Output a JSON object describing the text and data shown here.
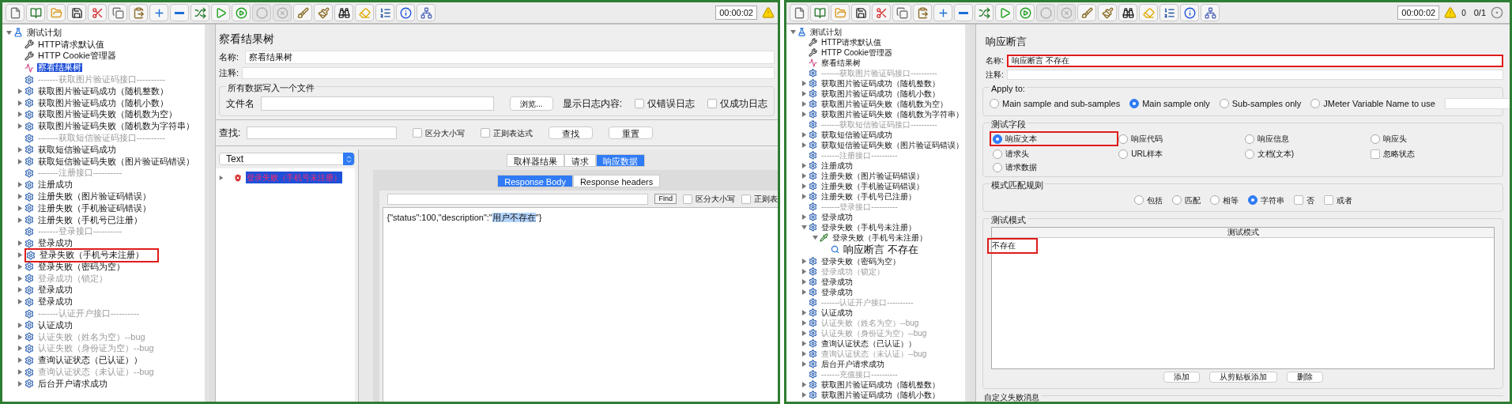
{
  "windows": [
    {
      "toolbar": [
        {
          "kind": "new",
          "disabled": false
        },
        {
          "kind": "templates",
          "disabled": false
        },
        {
          "kind": "open",
          "disabled": false
        },
        {
          "kind": "save",
          "disabled": false
        },
        {
          "kind": "cut",
          "disabled": false
        },
        {
          "kind": "copy",
          "disabled": false
        },
        {
          "kind": "paste",
          "disabled": false
        },
        {
          "kind": "expand",
          "disabled": false
        },
        {
          "kind": "collapse",
          "disabled": false
        },
        {
          "kind": "toggle",
          "disabled": false
        },
        {
          "kind": "start",
          "disabled": false
        },
        {
          "kind": "start_no_pause",
          "disabled": false
        },
        {
          "kind": "stop",
          "disabled": true
        },
        {
          "kind": "shutdown",
          "disabled": true
        },
        {
          "kind": "clear",
          "disabled": false
        },
        {
          "kind": "clear_all",
          "disabled": false
        },
        {
          "kind": "search",
          "disabled": false
        },
        {
          "kind": "reset_search",
          "disabled": false
        },
        {
          "kind": "functions",
          "disabled": false
        },
        {
          "kind": "help",
          "disabled": false
        },
        {
          "kind": "remote",
          "disabled": false
        }
      ],
      "timer": "00:00:02",
      "tree": [
        {
          "kind": "plan",
          "label": "测试计划",
          "expanded": true,
          "children": [
            {
              "kind": "config",
              "label": "HTTP请求默认值"
            },
            {
              "kind": "config",
              "label": "HTTP Cookie管理器"
            },
            {
              "kind": "listener",
              "label": "察看结果树",
              "selected": true
            },
            {
              "kind": "group",
              "label": "-------获取图片验证码接口----------",
              "disabled": true
            },
            {
              "kind": "group",
              "label": "获取图片验证码成功（随机整数）",
              "expanded": false
            },
            {
              "kind": "group",
              "label": "获取图片验证码成功（随机小数）",
              "expanded": false
            },
            {
              "kind": "group",
              "label": "获取图片验证码失败（随机数为空）",
              "expanded": false
            },
            {
              "kind": "group",
              "label": "获取图片验证码失败（随机数为字符串）",
              "expanded": false
            },
            {
              "kind": "group",
              "label": "-------获取短信验证码接口----------",
              "disabled": true
            },
            {
              "kind": "group",
              "label": "获取短信验证码成功",
              "expanded": false
            },
            {
              "kind": "group",
              "label": "获取短信验证码失败（图片验证码错误）",
              "expanded": false
            },
            {
              "kind": "group",
              "label": "-------注册接口----------",
              "disabled": true
            },
            {
              "kind": "group",
              "label": "注册成功",
              "expanded": false
            },
            {
              "kind": "group",
              "label": "注册失败（图片验证码错误）",
              "expanded": false
            },
            {
              "kind": "group",
              "label": "注册失败（手机验证码错误）",
              "expanded": false
            },
            {
              "kind": "group",
              "label": "注册失败（手机号已注册）",
              "expanded": false
            },
            {
              "kind": "group",
              "label": "-------登录接口----------",
              "disabled": true
            },
            {
              "kind": "group",
              "label": "登录成功",
              "expanded": false
            },
            {
              "kind": "group",
              "label": "登录失败（手机号未注册）",
              "expanded": false,
              "highlighted": true
            },
            {
              "kind": "group",
              "label": "登录失败（密码为空）",
              "expanded": false
            },
            {
              "kind": "group",
              "label": "登录成功（锁定）",
              "expanded": false,
              "disabled": true
            },
            {
              "kind": "group",
              "label": "登录成功",
              "expanded": false
            },
            {
              "kind": "group",
              "label": "登录成功",
              "expanded": false
            },
            {
              "kind": "group",
              "label": "-------认证开户接口----------",
              "disabled": true
            },
            {
              "kind": "group",
              "label": "认证成功",
              "expanded": false
            },
            {
              "kind": "group",
              "label": "认证失败（姓名为空）--bug",
              "expanded": false,
              "disabled": true
            },
            {
              "kind": "group",
              "label": "认证失败（身份证为空）--bug",
              "expanded": false,
              "disabled": true
            },
            {
              "kind": "group",
              "label": "查询认证状态（已认证））",
              "expanded": false
            },
            {
              "kind": "group",
              "label": "查询认证状态（未认证）--bug",
              "expanded": false,
              "disabled": true
            },
            {
              "kind": "group",
              "label": "后台开户请求成功",
              "expanded": false
            }
          ]
        }
      ],
      "panel": {
        "kind": "results_tree",
        "title": "察看结果树",
        "name_label": "名称:",
        "name_value": "察看结果树",
        "comment_label": "注释:",
        "file_group": {
          "legend": "所有数据写入一个文件",
          "file_label": "文件名",
          "browse_button": "浏览...",
          "log_label": "显示日志内容:",
          "options": [
            {
              "label": "仅错误日志",
              "checked": false
            },
            {
              "label": "仅成功日志",
              "checked": false
            }
          ]
        },
        "search": {
          "label": "查找:",
          "options": [
            {
              "label": "区分大小写",
              "checked": false
            },
            {
              "label": "正则表达式",
              "checked": false
            }
          ],
          "buttons": [
            "查找",
            "重置"
          ]
        },
        "renderer": "Text",
        "results": [
          {
            "label": "登录失败（手机号未注册）",
            "failed": true,
            "selected": true,
            "expanded": false
          }
        ],
        "tabs": [
          {
            "label": "取样器结果",
            "selected": false
          },
          {
            "label": "请求",
            "selected": false
          },
          {
            "label": "响应数据",
            "selected": true
          }
        ],
        "subtabs": [
          {
            "label": "Response Body",
            "selected": true
          },
          {
            "label": "Response headers",
            "selected": false
          }
        ],
        "find_button": "Find",
        "find_options": [
          {
            "label": "区分大小写",
            "checked": false
          },
          {
            "label": "正则表",
            "checked": false
          }
        ],
        "response_body": [
          {
            "text": "{\"status\":100,\"description\":\"",
            "highlighted": false
          },
          {
            "text": "用户不存在",
            "highlighted": true
          },
          {
            "text": "\"}",
            "highlighted": false
          }
        ]
      }
    },
    {
      "toolbar": [
        {
          "kind": "new",
          "disabled": false
        },
        {
          "kind": "templates",
          "disabled": false
        },
        {
          "kind": "open",
          "disabled": false
        },
        {
          "kind": "save",
          "disabled": false
        },
        {
          "kind": "cut",
          "disabled": false
        },
        {
          "kind": "copy",
          "disabled": false
        },
        {
          "kind": "paste",
          "disabled": false
        },
        {
          "kind": "expand",
          "disabled": false
        },
        {
          "kind": "collapse",
          "disabled": false
        },
        {
          "kind": "toggle",
          "disabled": false
        },
        {
          "kind": "start",
          "disabled": false
        },
        {
          "kind": "start_no_pause",
          "disabled": false
        },
        {
          "kind": "stop",
          "disabled": true
        },
        {
          "kind": "shutdown",
          "disabled": true
        },
        {
          "kind": "clear",
          "disabled": false
        },
        {
          "kind": "clear_all",
          "disabled": false
        },
        {
          "kind": "search",
          "disabled": false
        },
        {
          "kind": "reset_search",
          "disabled": false
        },
        {
          "kind": "functions",
          "disabled": false
        },
        {
          "kind": "help",
          "disabled": false
        },
        {
          "kind": "remote",
          "disabled": false
        }
      ],
      "timer": "00:00:02",
      "warnings": "0",
      "threads": "0/1",
      "tree": [
        {
          "kind": "plan",
          "label": "测试计划",
          "expanded": true,
          "children": [
            {
              "kind": "config",
              "label": "HTTP请求默认值"
            },
            {
              "kind": "config",
              "label": "HTTP Cookie管理器"
            },
            {
              "kind": "listener",
              "label": "察看结果树"
            },
            {
              "kind": "group",
              "label": "-------获取图片验证码接口----------",
              "disabled": true
            },
            {
              "kind": "group",
              "label": "获取图片验证码成功（随机整数）",
              "expanded": false
            },
            {
              "kind": "group",
              "label": "获取图片验证码成功（随机小数）",
              "expanded": false
            },
            {
              "kind": "group",
              "label": "获取图片验证码失败（随机数为空）",
              "expanded": false
            },
            {
              "kind": "group",
              "label": "获取图片验证码失败（随机数为字符串）",
              "expanded": false
            },
            {
              "kind": "group",
              "label": "-------获取短信验证码接口----------",
              "disabled": true
            },
            {
              "kind": "group",
              "label": "获取短信验证码成功",
              "expanded": false
            },
            {
              "kind": "group",
              "label": "获取短信验证码失败（图片验证码错误）",
              "expanded": false
            },
            {
              "kind": "group",
              "label": "-------注册接口----------",
              "disabled": true
            },
            {
              "kind": "group",
              "label": "注册成功",
              "expanded": false
            },
            {
              "kind": "group",
              "label": "注册失败（图片验证码错误）",
              "expanded": false
            },
            {
              "kind": "group",
              "label": "注册失败（手机验证码错误）",
              "expanded": false
            },
            {
              "kind": "group",
              "label": "注册失败（手机号已注册）",
              "expanded": false
            },
            {
              "kind": "group",
              "label": "-------登录接口----------",
              "disabled": true
            },
            {
              "kind": "group",
              "label": "登录成功",
              "expanded": false
            },
            {
              "kind": "group",
              "label": "登录失败（手机号未注册）",
              "expanded": true,
              "children": [
                {
                  "kind": "sampler",
                  "label": "登录失败（手机号未注册）",
                  "expanded": true,
                  "children": [
                    {
                      "kind": "assertion",
                      "label": "响应断言 不存在"
                    }
                  ]
                }
              ]
            },
            {
              "kind": "group",
              "label": "登录失败（密码为空）",
              "expanded": false
            },
            {
              "kind": "group",
              "label": "登录成功（锁定）",
              "expanded": false,
              "disabled": true
            },
            {
              "kind": "group",
              "label": "登录成功",
              "expanded": false
            },
            {
              "kind": "group",
              "label": "登录成功",
              "expanded": false
            },
            {
              "kind": "group",
              "label": "-------认证开户接口----------",
              "disabled": true
            },
            {
              "kind": "group",
              "label": "认证成功",
              "expanded": false
            },
            {
              "kind": "group",
              "label": "认证失败（姓名为空）--bug",
              "expanded": false,
              "disabled": true
            },
            {
              "kind": "group",
              "label": "认证失败（身份证为空）--bug",
              "expanded": false,
              "disabled": true
            },
            {
              "kind": "group",
              "label": "查询认证状态（已认证））",
              "expanded": false
            },
            {
              "kind": "group",
              "label": "查询认证状态（未认证）--bug",
              "expanded": false,
              "disabled": true
            },
            {
              "kind": "group",
              "label": "后台开户请求成功",
              "expanded": false
            },
            {
              "kind": "group",
              "label": "-------充值接口----------",
              "disabled": true
            },
            {
              "kind": "group",
              "label": "获取图片验证码成功（随机整数）",
              "expanded": false
            },
            {
              "kind": "group",
              "label": "获取图片验证码成功（随机小数）",
              "expanded": false
            }
          ]
        }
      ],
      "panel": {
        "kind": "response_assertion",
        "title": "响应断言",
        "name_label": "名称:",
        "name_value": "响应断言 不存在",
        "name_highlighted": true,
        "comment_label": "注释:",
        "apply_to": {
          "legend": "Apply to:",
          "options": [
            {
              "label": "Main sample and sub-samples",
              "selected": false
            },
            {
              "label": "Main sample only",
              "selected": true
            },
            {
              "label": "Sub-samples only",
              "selected": false
            },
            {
              "label": "JMeter Variable Name to use",
              "selected": false
            }
          ]
        },
        "fields": {
          "legend": "测试字段",
          "options": [
            {
              "kind": "radio",
              "label": "响应文本",
              "selected": true,
              "highlighted": true
            },
            {
              "kind": "radio",
              "label": "响应代码",
              "selected": false
            },
            {
              "kind": "radio",
              "label": "响应信息",
              "selected": false
            },
            {
              "kind": "radio",
              "label": "响应头",
              "selected": false
            },
            {
              "kind": "radio",
              "label": "请求头",
              "selected": false
            },
            {
              "kind": "radio",
              "label": "URL样本",
              "selected": false
            },
            {
              "kind": "radio",
              "label": "文档(文本)",
              "selected": false
            },
            {
              "kind": "checkbox",
              "label": "忽略状态",
              "checked": false
            },
            {
              "kind": "radio",
              "label": "请求数据",
              "selected": false
            }
          ]
        },
        "rules": {
          "legend": "模式匹配规则",
          "options": [
            {
              "kind": "radio",
              "label": "包括",
              "selected": false
            },
            {
              "kind": "radio",
              "label": "匹配",
              "selected": false
            },
            {
              "kind": "radio",
              "label": "相等",
              "selected": false
            },
            {
              "kind": "radio",
              "label": "字符串",
              "selected": true
            },
            {
              "kind": "checkbox",
              "label": "否",
              "checked": false
            },
            {
              "kind": "checkbox",
              "label": "或者",
              "checked": false
            }
          ]
        },
        "patterns": {
          "legend": "测试模式",
          "column": "测试模式",
          "rows": [
            {
              "value": "不存在",
              "highlighted": true
            }
          ],
          "buttons": [
            "添加",
            "从剪贴板添加",
            "删除"
          ]
        },
        "failure_message": {
          "legend": "自定义失败消息"
        }
      }
    }
  ]
}
